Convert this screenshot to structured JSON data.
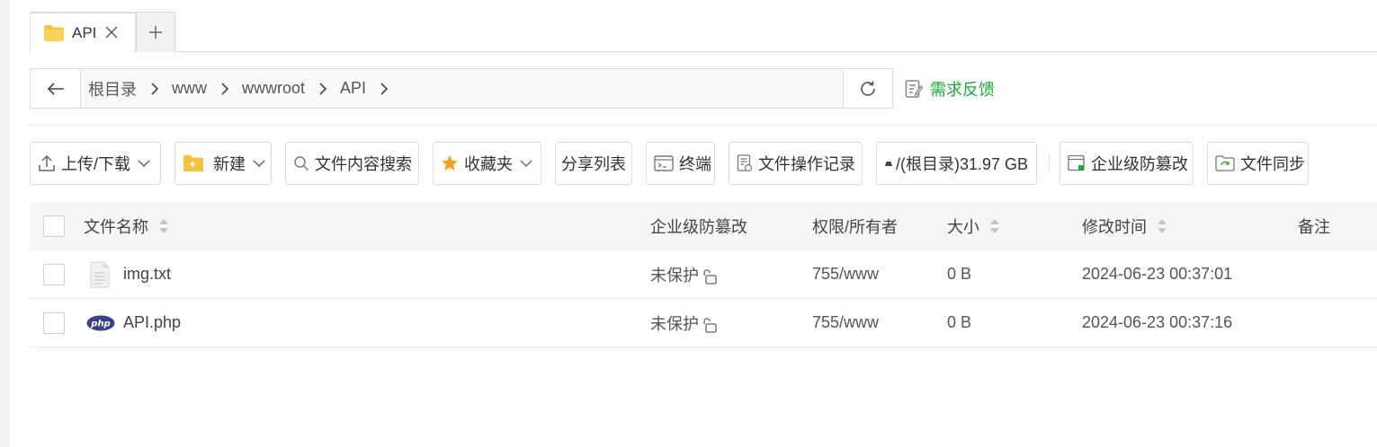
{
  "tabs": [
    {
      "label": "API",
      "icon": "folder-icon",
      "active": true
    }
  ],
  "breadcrumb": [
    "根目录",
    "www",
    "wwwroot",
    "API"
  ],
  "feedback_label": "需求反馈",
  "toolbar": {
    "upload_download": "上传/下载",
    "new": "新建",
    "search": "文件内容搜索",
    "favorites": "收藏夹",
    "share_list": "分享列表",
    "terminal": "终端",
    "operation_log": "文件操作记录",
    "disk": "/(根目录)31.97 GB",
    "tamper_proof": "企业级防篡改",
    "sync": "文件同步"
  },
  "table": {
    "headers": {
      "name": "文件名称",
      "tamper": "企业级防篡改",
      "permission": "权限/所有者",
      "size": "大小",
      "modified": "修改时间",
      "note": "备注"
    },
    "rows": [
      {
        "name": "img.txt",
        "icon": "text-file-icon",
        "tamper": "未保护",
        "permission": "755/www",
        "size": "0 B",
        "modified": "2024-06-23 00:37:01"
      },
      {
        "name": "API.php",
        "icon": "php-file-icon",
        "tamper": "未保护",
        "permission": "755/www",
        "size": "0 B",
        "modified": "2024-06-23 00:37:16"
      }
    ]
  },
  "colors": {
    "accent_green": "#20a53a",
    "folder_yellow": "#f5c242",
    "star": "#f0a020"
  }
}
